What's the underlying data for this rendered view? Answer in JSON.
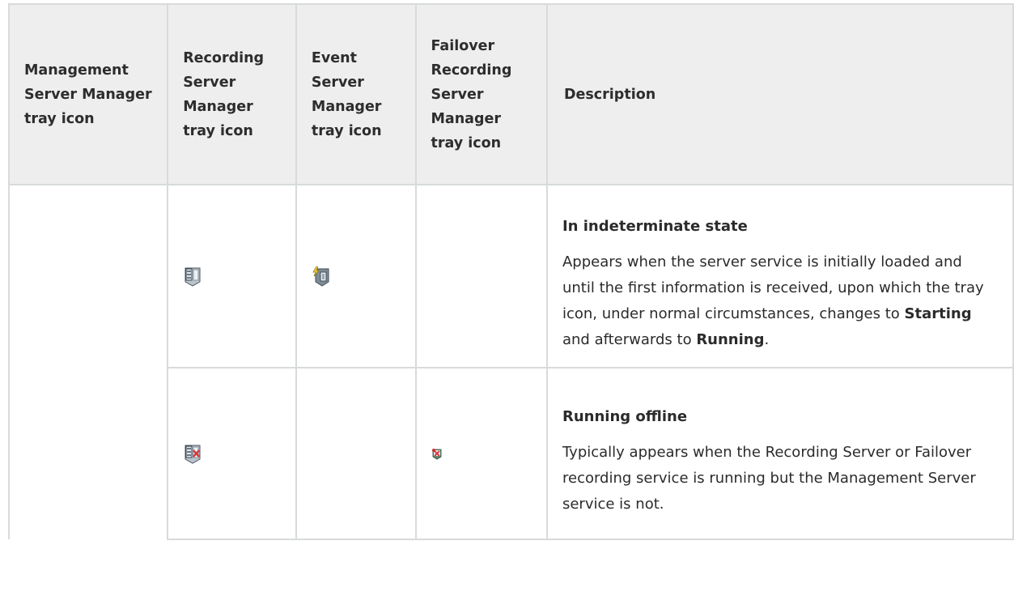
{
  "table": {
    "headers": [
      "Management Server Manager tray icon",
      "Recording Server Manager tray icon",
      "Event Server Manager tray icon",
      "Failover Recording Server Manager tray icon",
      "Description"
    ],
    "rows": [
      {
        "recording_icon": "recording-server-indeterminate-icon",
        "event_icon": "event-server-indeterminate-icon",
        "failover_icon": "",
        "title": "In indeterminate state",
        "desc_part1": "Appears when the server service is initially loaded and until the first information is received, upon which the tray icon, under normal circumstances, changes to ",
        "desc_bold1": "Starting",
        "desc_part2": " and afterwards to ",
        "desc_bold2": "Running",
        "desc_part3": "."
      },
      {
        "recording_icon": "recording-server-offline-icon",
        "event_icon": "",
        "failover_icon": "failover-server-offline-icon",
        "title": "Running offline",
        "desc_part1": "Typically appears when the Recording Server or Failover recording service is running but the Management Server service is not."
      }
    ]
  },
  "colors": {
    "header_bg": "#eeeeee",
    "border": "#d7dbd9",
    "text": "#2b2b2b",
    "offline_red": "#d9343a",
    "event_yellow": "#f2d33a"
  }
}
